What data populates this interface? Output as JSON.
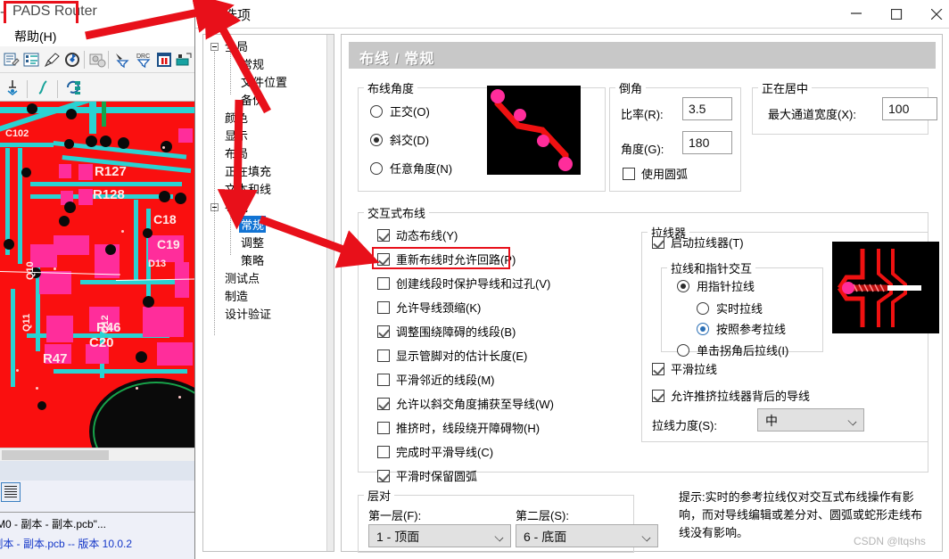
{
  "background_app": {
    "title": "PADS Router",
    "title_prefix": "-",
    "menu": [
      {
        "label": "帮助(H)"
      }
    ],
    "status_line_1": "M0 - 副本 - 副本.pcb\"...",
    "status_line_2": "- 副本 - 副本.pcb -- 版本  10.0.2",
    "pcb_refdes": [
      "C102",
      "R127",
      "R128",
      "C18",
      "C19",
      "D13",
      "Q10",
      "Q11",
      "Q12",
      "R46",
      "R47",
      "C20"
    ]
  },
  "dialog": {
    "title": "选项",
    "icon": "routing-icon",
    "window_buttons": {
      "minimize": "minimize-icon",
      "maximize": "maximize-icon",
      "close": "close-icon"
    },
    "tree": [
      {
        "label": "全局",
        "level": 0,
        "expandable": true,
        "selected": false
      },
      {
        "label": "常规",
        "level": 1,
        "expandable": false,
        "selected": false
      },
      {
        "label": "文件位置",
        "level": 1,
        "expandable": false,
        "selected": false
      },
      {
        "label": "备份",
        "level": 1,
        "expandable": false,
        "selected": false
      },
      {
        "label": "颜色",
        "level": 0,
        "expandable": false,
        "selected": false
      },
      {
        "label": "显示",
        "level": 0,
        "expandable": false,
        "selected": false
      },
      {
        "label": "布局",
        "level": 0,
        "expandable": false,
        "selected": false
      },
      {
        "label": "正在填充",
        "level": 0,
        "expandable": false,
        "selected": false
      },
      {
        "label": "文本和线",
        "level": 0,
        "expandable": false,
        "selected": false
      },
      {
        "label": "布线",
        "level": 0,
        "expandable": true,
        "selected": false
      },
      {
        "label": "常规",
        "level": 1,
        "expandable": false,
        "selected": true
      },
      {
        "label": "调整",
        "level": 1,
        "expandable": false,
        "selected": false
      },
      {
        "label": "策略",
        "level": 1,
        "expandable": false,
        "selected": false
      },
      {
        "label": "测试点",
        "level": 0,
        "expandable": false,
        "selected": false
      },
      {
        "label": "制造",
        "level": 0,
        "expandable": false,
        "selected": false
      },
      {
        "label": "设计验证",
        "level": 0,
        "expandable": false,
        "selected": false
      }
    ],
    "panel_header": "布线 / 常规",
    "routing_angle": {
      "legend": "布线角度",
      "options": [
        {
          "label": "正交(O)",
          "selected": false
        },
        {
          "label": "斜交(D)",
          "selected": true
        },
        {
          "label": "任意角度(N)",
          "selected": false
        }
      ]
    },
    "chamfer": {
      "legend": "倒角",
      "ratio_label": "比率(R):",
      "ratio_value": "3.5",
      "angle_label": "角度(G):",
      "angle_value": "180",
      "use_arc_label": "使用圆弧",
      "use_arc_checked": false
    },
    "centering": {
      "legend": "正在居中",
      "max_width_label": "最大通道宽度(X):",
      "max_width_value": "100"
    },
    "interactive_routing": {
      "legend": "交互式布线",
      "items": [
        {
          "label": "动态布线(Y)",
          "checked": true,
          "highlighted": false
        },
        {
          "label": "重新布线时允许回路(P)",
          "checked": true,
          "highlighted": true
        },
        {
          "label": "创建线段时保护导线和过孔(V)",
          "checked": false,
          "highlighted": false
        },
        {
          "label": "允许导线颈缩(K)",
          "checked": false,
          "highlighted": false
        },
        {
          "label": "调整围绕障碍的线段(B)",
          "checked": true,
          "highlighted": false
        },
        {
          "label": "显示管脚对的估计长度(E)",
          "checked": false,
          "highlighted": false
        },
        {
          "label": "平滑邻近的线段(M)",
          "checked": false,
          "highlighted": false
        },
        {
          "label": "允许以斜交角度捕获至导线(W)",
          "checked": true,
          "highlighted": false
        },
        {
          "label": "推挤时，线段绕开障碍物(H)",
          "checked": false,
          "highlighted": false
        },
        {
          "label": "完成时平滑导线(C)",
          "checked": false,
          "highlighted": false
        },
        {
          "label": "平滑时保留圆弧",
          "checked": true,
          "highlighted": false
        }
      ]
    },
    "rubberband": {
      "legend": "拉线器",
      "enable_label": "启动拉线器(T)",
      "enable_checked": true,
      "interaction": {
        "legend": "拉线和指针交互",
        "pointer_option": {
          "label": "用指针拉线",
          "selected": true
        },
        "sub_options": [
          {
            "label": "实时拉线",
            "selected": false
          },
          {
            "label": "按照参考拉线",
            "selected": true
          }
        ],
        "corner_option": {
          "label": "单击拐角后拉线(I)",
          "selected": false
        }
      },
      "smooth_label": "平滑拉线",
      "smooth_checked": true,
      "push_label": "允许推挤拉线器背后的导线",
      "push_checked": true,
      "strength_label": "拉线力度(S):",
      "strength_value": "中"
    },
    "layer_pair": {
      "legend": "层对",
      "first_label": "第一层(F):",
      "first_value": "1 - 顶面",
      "second_label": "第二层(S):",
      "second_value": "6 - 底面"
    },
    "tip_text": "提示:实时的参考拉线仅对交互式布线操作有影响，而对导线编辑或差分对、圆弧或蛇形走线布线没有影响。"
  },
  "annotations": {
    "accent_color": "#e8101a",
    "selection_color": "#1274d4",
    "watermark": "CSDN @ltqshs"
  }
}
